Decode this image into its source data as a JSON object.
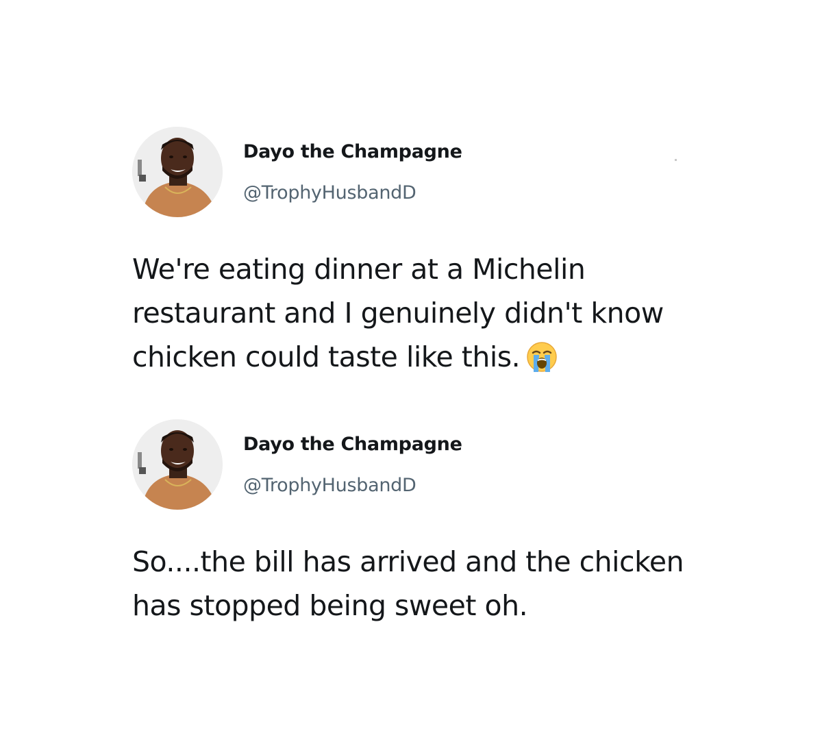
{
  "tweets": [
    {
      "author": {
        "display_name": "Dayo the Champagne",
        "handle": "@TrophyHusbandD",
        "avatar_icon": "profile-photo"
      },
      "text": "We're eating dinner at a Michelin restaurant and I genuinely didn't know chicken could taste like this.",
      "emoji": "loudly-crying-face"
    },
    {
      "author": {
        "display_name": "Dayo the Champagne",
        "handle": "@TrophyHusbandD",
        "avatar_icon": "profile-photo"
      },
      "text": "So....the bill has arrived and the chicken has stopped being sweet oh."
    }
  ],
  "colors": {
    "background": "#ffffff",
    "text": "#14171a",
    "handle": "#536471"
  }
}
